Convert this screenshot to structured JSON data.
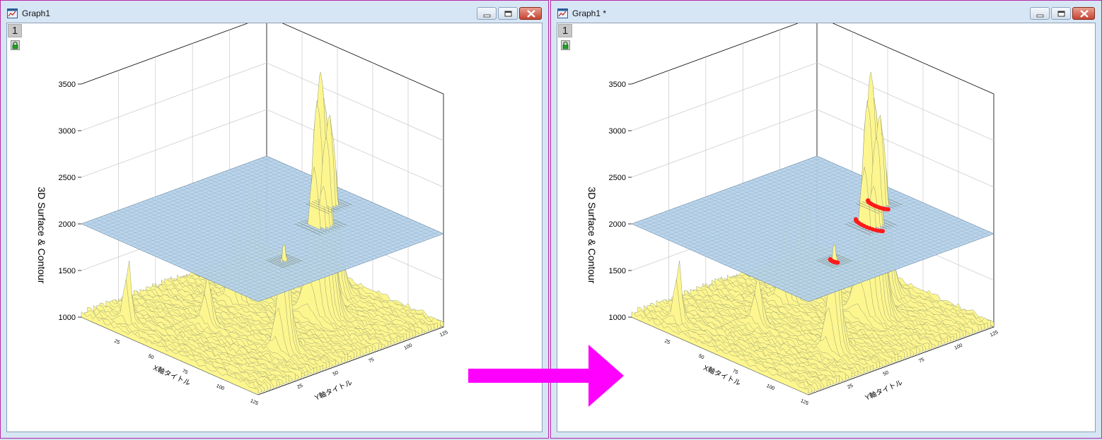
{
  "left_window": {
    "title": "Graph1",
    "layer": "1"
  },
  "right_window": {
    "title": "Graph1 *",
    "layer": "1"
  },
  "window_controls": {
    "minimize": "minimize-icon",
    "restore": "restore-icon",
    "close": "close-icon"
  },
  "colors": {
    "window_border": "#b92aa6",
    "surface_fill": "#fdf68f",
    "plane_fill": "#b6d3ea",
    "marker": "#ff1a1a",
    "arrow": "#ff00ff"
  },
  "chart_data": [
    {
      "type": "3d-surface",
      "zlabel": "3D Surface & Contour",
      "xlabel": "X軸タイトル",
      "ylabel": "Y軸タイトル",
      "zticks": [
        "3500",
        "3000",
        "2500",
        "2000",
        "1500",
        "1000"
      ],
      "ylim": [
        1000,
        3500
      ],
      "xticks": [
        "25",
        "50",
        "75",
        "100",
        "125"
      ],
      "yticks": [
        "25",
        "50",
        "75",
        "100",
        "125"
      ],
      "contour_plane": 2000,
      "markers": false
    },
    {
      "type": "3d-surface",
      "zlabel": "3D Surface & Contour",
      "xlabel": "X軸タイトル",
      "ylabel": "Y軸タイトル",
      "zticks": [
        "3500",
        "3000",
        "2500",
        "2000",
        "1500",
        "1000"
      ],
      "ylim": [
        1000,
        3500
      ],
      "xticks": [
        "25",
        "50",
        "75",
        "100",
        "125"
      ],
      "yticks": [
        "25",
        "50",
        "75",
        "100",
        "125"
      ],
      "contour_plane": 2000,
      "markers": true
    }
  ]
}
